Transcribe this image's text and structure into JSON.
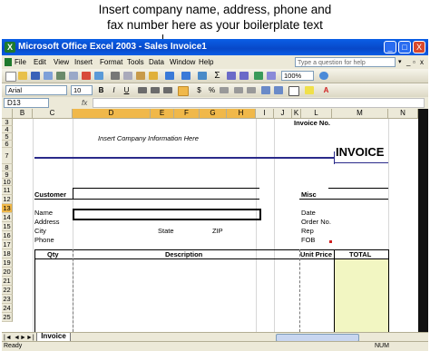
{
  "callout": {
    "line1": "Insert company name, address, phone and",
    "line2": "fax number here as your boilerplate text"
  },
  "window": {
    "title": "Microsoft Office Excel 2003 - Sales Invoice1",
    "min": "_",
    "max": "□",
    "close": "X"
  },
  "menu": {
    "items": [
      "File",
      "Edit",
      "View",
      "Insert",
      "Format",
      "Tools",
      "Data",
      "Window",
      "Help"
    ],
    "help_placeholder": "Type a question for help"
  },
  "toolbar": {
    "zoom": "100%",
    "font_name": "Arial",
    "font_size": "10",
    "bold": "B",
    "italic": "I",
    "underline": "U",
    "currency": "$",
    "percent": "%",
    "font_color": "A"
  },
  "formula_bar": {
    "name_box": "D13",
    "fx": "fx",
    "formula": ""
  },
  "columns": [
    "B",
    "C",
    "D",
    "E",
    "F",
    "G",
    "H",
    "I",
    "J",
    "K",
    "L",
    "M",
    "N"
  ],
  "rows": [
    "3",
    "4",
    "5",
    "6",
    "7",
    "8",
    "9",
    "10",
    "11",
    "12",
    "13",
    "14",
    "15",
    "16",
    "17",
    "18",
    "19",
    "20",
    "21",
    "22",
    "23",
    "24",
    "25"
  ],
  "sheet": {
    "invoice_no_label": "Invoice No.",
    "company_info": "Insert Company Information Here",
    "invoice_title": "INVOICE",
    "customer_heading": "Customer",
    "misc_heading": "Misc",
    "name_label": "Name",
    "address_label": "Address",
    "city_label": "City",
    "state_label": "State",
    "zip_label": "ZIP",
    "phone_label": "Phone",
    "date_label": "Date",
    "order_label": "Order No.",
    "rep_label": "Rep",
    "fob_label": "FOB",
    "qty_header": "Qty",
    "desc_header": "Description",
    "unit_price_header": "Unit Price",
    "total_header": "TOTAL"
  },
  "tabs": {
    "active": "Invoice",
    "nav_first": "|◄",
    "nav_prev": "◄",
    "nav_next": "►",
    "nav_last": "►|"
  },
  "status": {
    "left": "Ready",
    "right": "NUM"
  },
  "colors": {
    "title_blue": "#0a5ee6",
    "selected_header": "#f0b84a",
    "total_fill": "#f2f6c2",
    "invoice_rule": "#2a2a8a"
  }
}
